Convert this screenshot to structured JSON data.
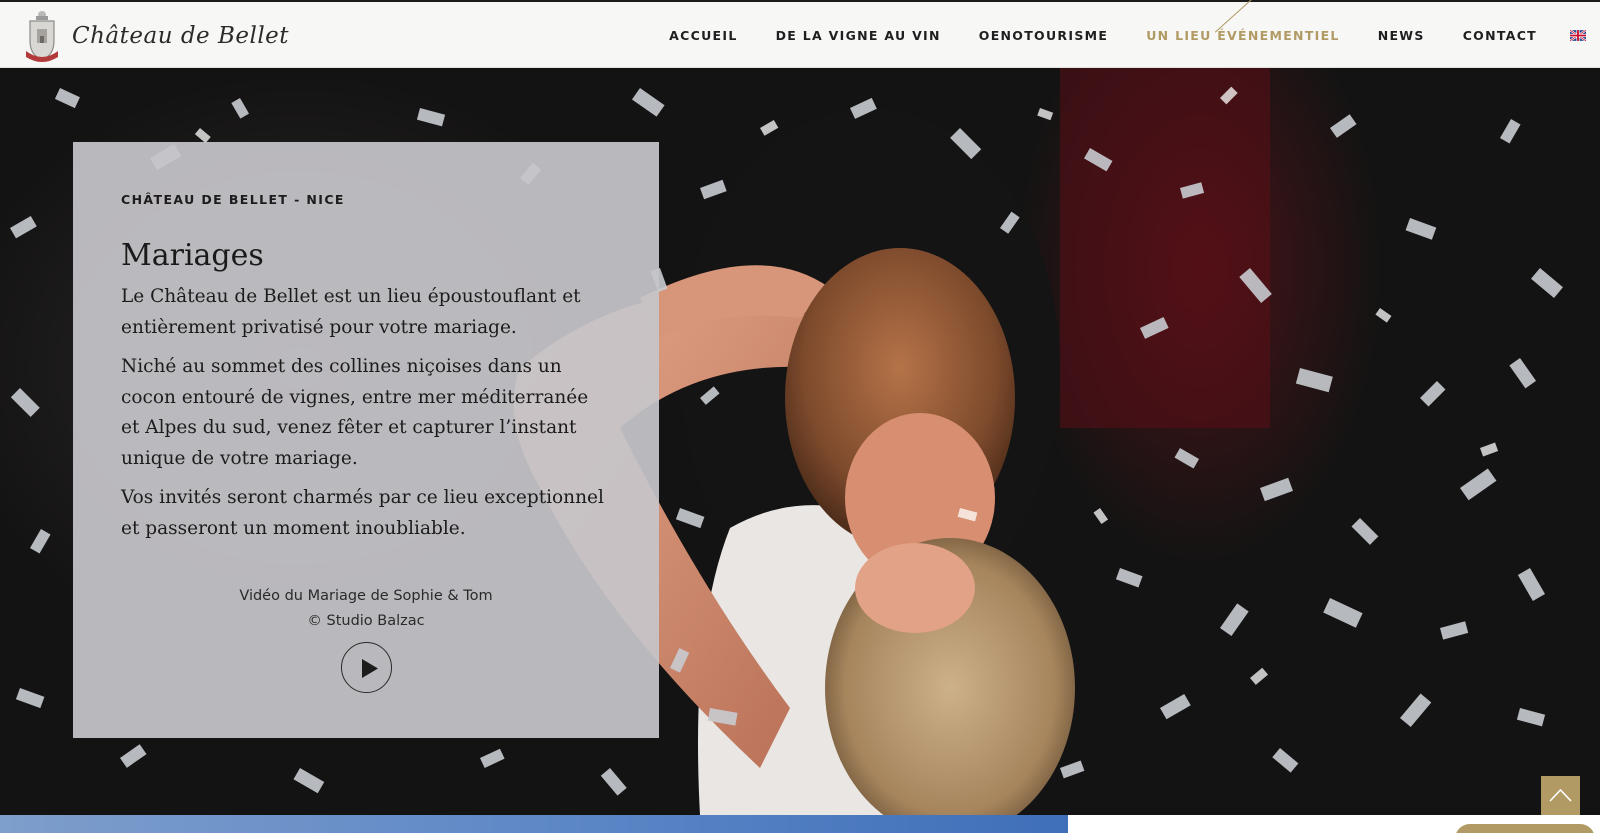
{
  "header": {
    "logo_text": "Château de Bellet",
    "nav": [
      {
        "label": "ACCUEIL",
        "active": false
      },
      {
        "label": "DE LA VIGNE AU VIN",
        "active": false
      },
      {
        "label": "OENOTOURISME",
        "active": false
      },
      {
        "label": "UN LIEU ÉVÉNEMENTIEL",
        "active": true
      },
      {
        "label": "NEWS",
        "active": false
      },
      {
        "label": "CONTACT",
        "active": false
      }
    ],
    "language_icon": "uk-flag-icon"
  },
  "hero": {
    "image_subject": "couple-kissing-under-silver-confetti",
    "card": {
      "eyebrow": "CHÂTEAU DE BELLET - NICE",
      "title": "Mariages",
      "paragraphs": [
        "Le Château de Bellet est un lieu époustouflant et entièrement privatisé pour votre mariage.",
        "Niché au sommet des collines niçoises dans un cocon entouré de vignes, entre mer méditerranée et Alpes du sud, venez fêter et capturer l’instant unique de votre mariage.",
        "Vos invités seront charmés par ce lieu exceptionnel et passeront un moment inoubliable."
      ],
      "video_caption_line1": "Vidéo du Mariage de Sophie & Tom",
      "video_caption_line2": "© Studio Balzac",
      "play_icon": "play-icon"
    }
  },
  "back_to_top_icon": "chevron-up-icon",
  "colors": {
    "accent": "#b19a63",
    "header_bg": "#f7f7f6",
    "card_bg": "#c6c5c9",
    "text_dark": "#1c1c1c"
  }
}
